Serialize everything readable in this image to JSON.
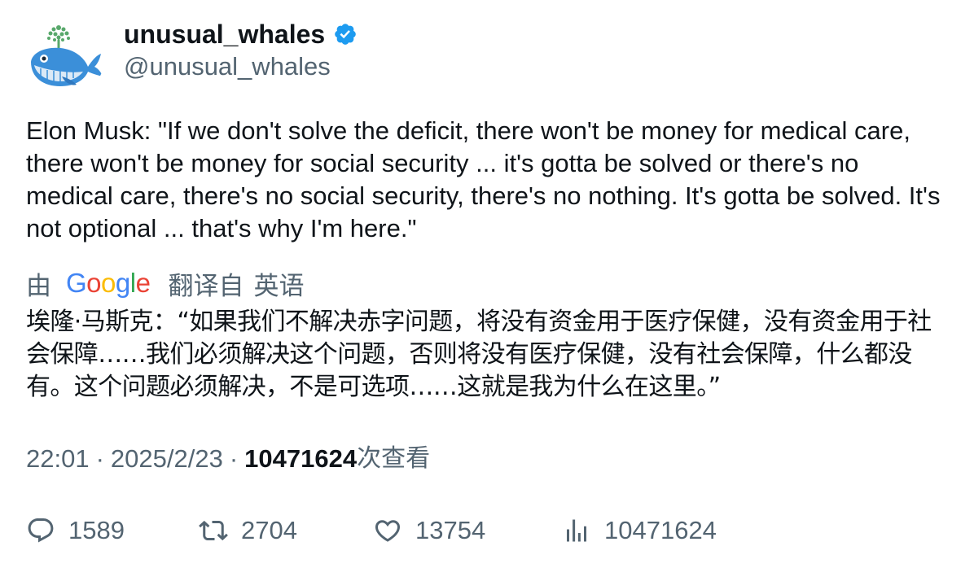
{
  "author": {
    "display_name": "unusual_whales",
    "handle": "@unusual_whales",
    "verified": true,
    "avatar_icon": "whale-logo-icon",
    "verified_color": "#1d9bf0"
  },
  "tweet": {
    "text": "Elon Musk: \"If we don't solve the deficit, there won't be money for medical care, there won't be money for social security ... it's gotta be solved or there's no medical care, there's no social security, there's no nothing. It's gotta be solved. It's not optional ... that's why I'm here.\""
  },
  "translation": {
    "by_label": "由",
    "provider": "Google",
    "from_label": "翻译自",
    "language": "英语",
    "text": "埃隆·马斯克：“如果我们不解决赤字问题，将没有资金用于医疗保健，没有资金用于社会保障……我们必须解决这个问题，否则将没有医疗保健，没有社会保障，什么都没有。这个问题必须解决，不是可选项……这就是我为什么在这里。”"
  },
  "meta": {
    "time": "22:01",
    "separator": "·",
    "date": "2025/2/23",
    "views_count": "10471624",
    "views_label": "次查看"
  },
  "actions": {
    "replies": "1589",
    "retweets": "2704",
    "likes": "13754",
    "views": "10471624"
  },
  "colors": {
    "text_primary": "#0f1419",
    "text_secondary": "#536471",
    "google_blue": "#4285F4",
    "google_red": "#EA4335",
    "google_yellow": "#FBBC05",
    "google_green": "#34A853"
  }
}
